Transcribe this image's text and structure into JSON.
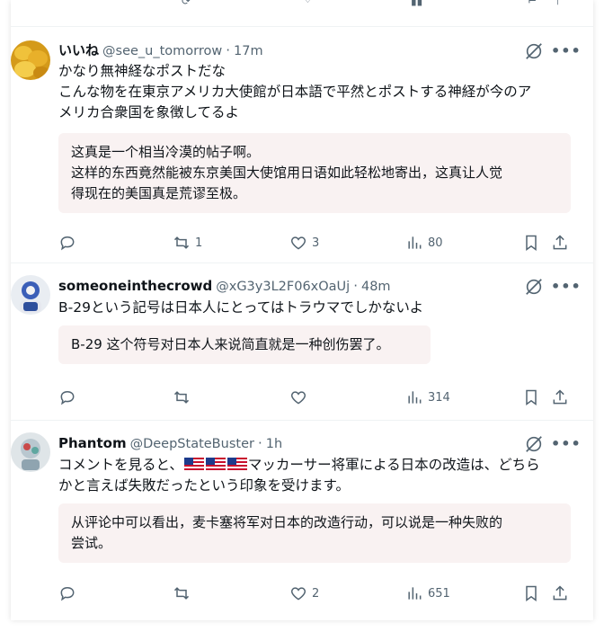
{
  "tweets": [
    {
      "name": "いいね",
      "handle": "@see_u_tomorrow",
      "dot": "·",
      "time": "17m",
      "text_lines": [
        "かなり無神経なポストだな",
        "こんな物を在東京アメリカ大使館が日本語で平然とポストする神経が今のア",
        "メリカ合衆国を象徴してるよ"
      ],
      "translation_lines": [
        "这真是一个相当冷漠的帖子啊。",
        "这样的东西竟然能被东京美国大使馆用日语如此轻松地寄出，这真让人觉",
        "得现在的美国真是荒谬至极。"
      ],
      "replies": "",
      "retweets": "1",
      "likes": "3",
      "views": "80"
    },
    {
      "name": "someoneinthecrowd",
      "handle": "@xG3y3L2F06xOaUj",
      "dot": "·",
      "time": "48m",
      "text_lines": [
        "B-29という記号は日本人にとってはトラウマでしかないよ"
      ],
      "translation_lines": [
        "B-29 这个符号对日本人来说简直就是一种创伤罢了。"
      ],
      "replies": "",
      "retweets": "",
      "likes": "",
      "views": "314"
    },
    {
      "name": "Phantom",
      "handle": "@DeepStateBuster",
      "dot": "·",
      "time": "1h",
      "text_line1_pre": "コメントを見ると、",
      "text_line1_post": "マッカーサー将軍による日本の改造は、どちら",
      "text_lines": [
        "かと言えば失敗だったという印象を受けます。"
      ],
      "translation_lines": [
        "从评论中可以看出，麦卡塞将军对日本的改造行动，可以说是一种失败的",
        "尝试。"
      ],
      "replies": "",
      "retweets": "",
      "likes": "2",
      "views": "651"
    }
  ],
  "icons": {
    "reply": "reply-icon",
    "retweet": "retweet-icon",
    "like": "heart-icon",
    "views": "analytics-icon",
    "bookmark": "bookmark-icon",
    "share": "share-icon",
    "grok": "grok-icon",
    "more": "more-icon"
  },
  "more_glyph": "•••",
  "colors": {
    "secondary_text": "#536471",
    "translation_bg": "#f9f2f2",
    "border": "#eff3f4"
  }
}
